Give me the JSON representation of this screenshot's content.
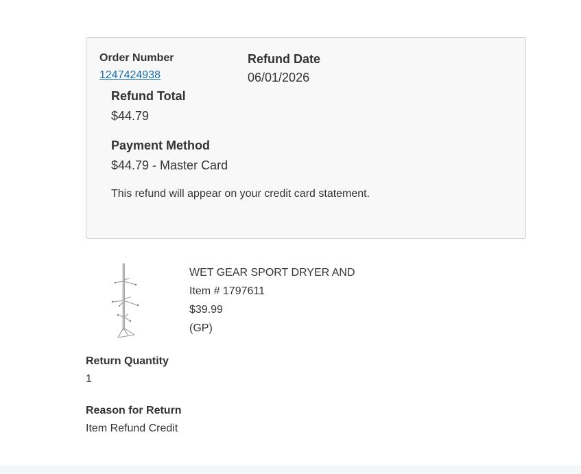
{
  "order": {
    "number_label": "Order Number",
    "number": "1247424938",
    "date_label": "Refund Date",
    "date": "06/01/2026",
    "total_label": "Refund Total",
    "total": "$44.79",
    "payment_label": "Payment Method",
    "payment": "$44.79 - Master Card",
    "note": "This refund will appear on your credit card statement."
  },
  "item": {
    "name": "WET GEAR SPORT DRYER AND",
    "number": "Item # 1797611",
    "price": "$39.99",
    "tag": "(GP)",
    "image_icon": "sport-dryer-rack-image"
  },
  "return": {
    "quantity_label": "Return Quantity",
    "quantity": "1",
    "reason_label": "Reason for Return",
    "reason": "Item Refund Credit"
  },
  "colors": {
    "link": "#1a6dad",
    "card_bg": "#f8f8f8",
    "card_border": "#cfcfcf"
  }
}
